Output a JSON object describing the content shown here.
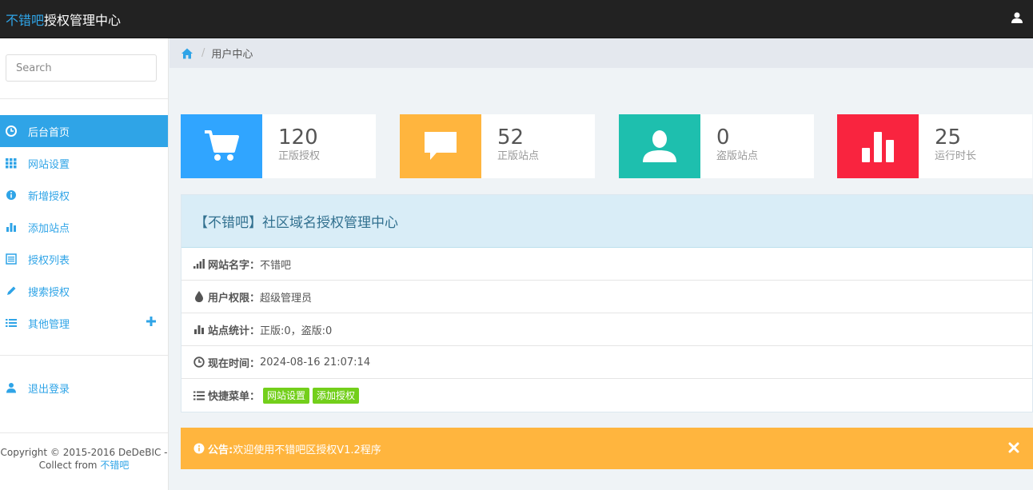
{
  "header": {
    "brand_highlight": "不错吧",
    "brand_rest": "授权管理中心"
  },
  "sidebar": {
    "search_placeholder": "Search",
    "items": [
      {
        "label": "后台首页",
        "icon": "dashboard-icon",
        "active": true
      },
      {
        "label": "网站设置",
        "icon": "grid-icon"
      },
      {
        "label": "新增授权",
        "icon": "info-icon"
      },
      {
        "label": "添加站点",
        "icon": "bar-chart-icon"
      },
      {
        "label": "授权列表",
        "icon": "list-alt-icon"
      },
      {
        "label": "搜索授权",
        "icon": "pencil-icon"
      },
      {
        "label": "其他管理",
        "icon": "list-icon"
      }
    ],
    "logout_label": "退出登录",
    "copyright_line1": "Copyright © 2015-2016 DeDeBIC -",
    "copyright_line2_prefix": "Collect from ",
    "copyright_link": "不错吧"
  },
  "breadcrumb": {
    "current": "用户中心"
  },
  "stats": [
    {
      "value": "120",
      "label": "正版授权",
      "color": "#30a5ff",
      "icon": "shopping-cart-icon"
    },
    {
      "value": "52",
      "label": "正版站点",
      "color": "#ffb53e",
      "icon": "comment-icon"
    },
    {
      "value": "0",
      "label": "盗版站点",
      "color": "#1ebfae",
      "icon": "user-icon"
    },
    {
      "value": "25",
      "label": "运行时长",
      "color": "#f9243f",
      "icon": "bar-chart-icon"
    }
  ],
  "panel": {
    "title": "【不错吧】社区域名授权管理中心",
    "rows": {
      "site_name_label": "网站名字：",
      "site_name_value": "不错吧",
      "permission_label": "用户权限：",
      "permission_value": "超级管理员",
      "stats_label": "站点统计：",
      "stats_value": " 正版:0，盗版:0",
      "time_label": "现在时间：",
      "time_value": " 2024-08-16 21:07:14",
      "menu_label": "快捷菜单："
    },
    "quick_menu": [
      "网站设置",
      "添加授权"
    ]
  },
  "notice": {
    "label": "公告:",
    "text": " 欢迎使用不错吧区授权V1.2程序"
  },
  "colors": {
    "accent": "#2fa4e7",
    "topbar": "#222222",
    "tag_green": "#73cf1b",
    "notice_orange": "#ffb53e"
  }
}
